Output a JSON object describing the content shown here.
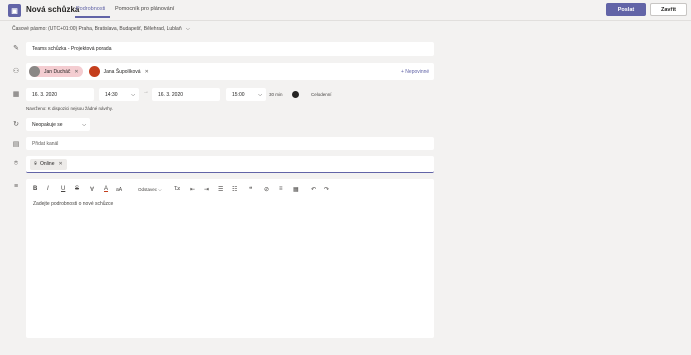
{
  "header": {
    "app_icon_glyph": "▣",
    "title": "Nová schůzka",
    "tabs": [
      {
        "label": "Podrobnosti",
        "active": true
      },
      {
        "label": "Pomocník pro plánování",
        "active": false
      }
    ],
    "send_label": "Poslat",
    "close_label": "Zavřít"
  },
  "timezone": {
    "label": "Časové pásmo: (UTC+01:00) Praha, Bratislava, Budapešť, Bělehrad, Lublaň",
    "chevron": "⌵"
  },
  "title_field": {
    "value": "Teams schůzka - Projektová porada"
  },
  "attendees": {
    "people": [
      {
        "name": "Jan Ducháč",
        "avatar_color": "#8a8886"
      },
      {
        "name": "Jana Šupolíková",
        "avatar_color": "#c43e1c"
      }
    ],
    "optional_label": "+ Nepovinné"
  },
  "datetime": {
    "start_date": "16. 3. 2020",
    "start_time": "14:30",
    "arrow": "→",
    "end_date": "16. 3. 2020",
    "end_time": "15:00",
    "duration": "30 min",
    "all_day_label": "Celodenní",
    "suggestion": "Navrženo: K dispozici nejsou žádné návrhy."
  },
  "repeat": {
    "value": "Neopakuje se"
  },
  "channel": {
    "placeholder": "Přidat kanál"
  },
  "location": {
    "value": "Online"
  },
  "toolbar": {
    "bold": "B",
    "italic": "I",
    "underline": "U",
    "strike": "S",
    "highlight": "∀",
    "font_color": "A",
    "font_size": "aA",
    "paragraph": "Odstavec ⌵",
    "clear_format": "T̶x",
    "outdent": "⇤",
    "indent": "⇥",
    "bullets": "☰",
    "numbering": "☷",
    "quote": "❝",
    "link": "⊘",
    "hr": "≡",
    "table": "▦",
    "undo": "↶",
    "redo": "↷"
  },
  "editor": {
    "placeholder": "Zadejte podrobnosti o nové schůzce"
  },
  "icons": {
    "pencil": "✎",
    "people": "⚇",
    "calendar": "▦",
    "repeat": "↻",
    "channel": "▤",
    "location": "⌾",
    "details": "≡"
  }
}
